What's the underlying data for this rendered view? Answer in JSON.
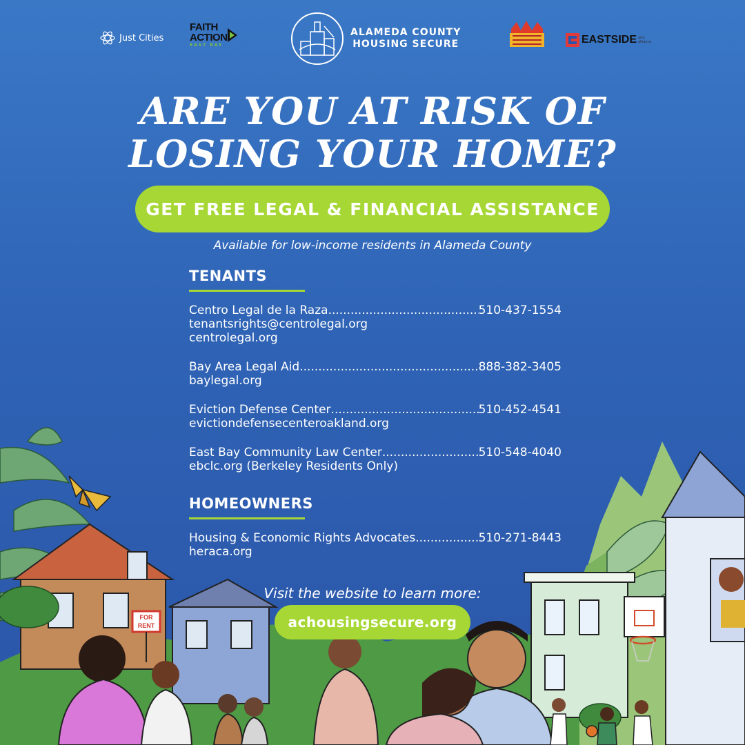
{
  "logos": {
    "just_cities": "Just Cities",
    "faith_line1": "FAITH",
    "faith_line2": "ACTION",
    "faith_sub": "EAST BAY",
    "ach_line1": "ALAMEDA COUNTY",
    "ach_line2": "HOUSING SECURE",
    "holding_icon": "holding-our-ground-logo",
    "eastside": "EASTSIDE",
    "eastside_sub": "arts alliance"
  },
  "headline": {
    "line1": "ARE YOU AT RISK OF",
    "line2": "LOSING YOUR HOME?"
  },
  "cta": "GET FREE LEGAL & FINANCIAL ASSISTANCE",
  "subnote": "Available for low-income residents in Alameda County",
  "tenants": {
    "title": "TENANTS",
    "entries": [
      {
        "name": "Centro Legal de la Raza",
        "phone": "510-437-1554",
        "lines": [
          "tenantsrights@centrolegal.org",
          "centrolegal.org"
        ]
      },
      {
        "name": "Bay Area Legal Aid",
        "phone": "888-382-3405",
        "lines": [
          "baylegal.org"
        ]
      },
      {
        "name": "Eviction Defense Center",
        "phone": "510-452-4541",
        "lines": [
          "evictiondefensecenteroakland.org"
        ]
      },
      {
        "name": "East Bay Community Law Center",
        "phone": "510-548-4040",
        "lines": [
          "ebclc.org (Berkeley Residents Only)"
        ]
      }
    ]
  },
  "homeowners": {
    "title": "HOMEOWNERS",
    "entries": [
      {
        "name": "Housing & Economic Rights Advocates",
        "phone": "510-271-8443",
        "lines": [
          "heraca.org"
        ]
      }
    ]
  },
  "visit_text": "Visit the website to learn more:",
  "website": "achousingsecure.org",
  "illustration": {
    "sign_line1": "FOR",
    "sign_line2": "RENT"
  },
  "colors": {
    "background_top": "#3a78c6",
    "background_bottom": "#2b55a8",
    "accent_green": "#a6d735"
  }
}
